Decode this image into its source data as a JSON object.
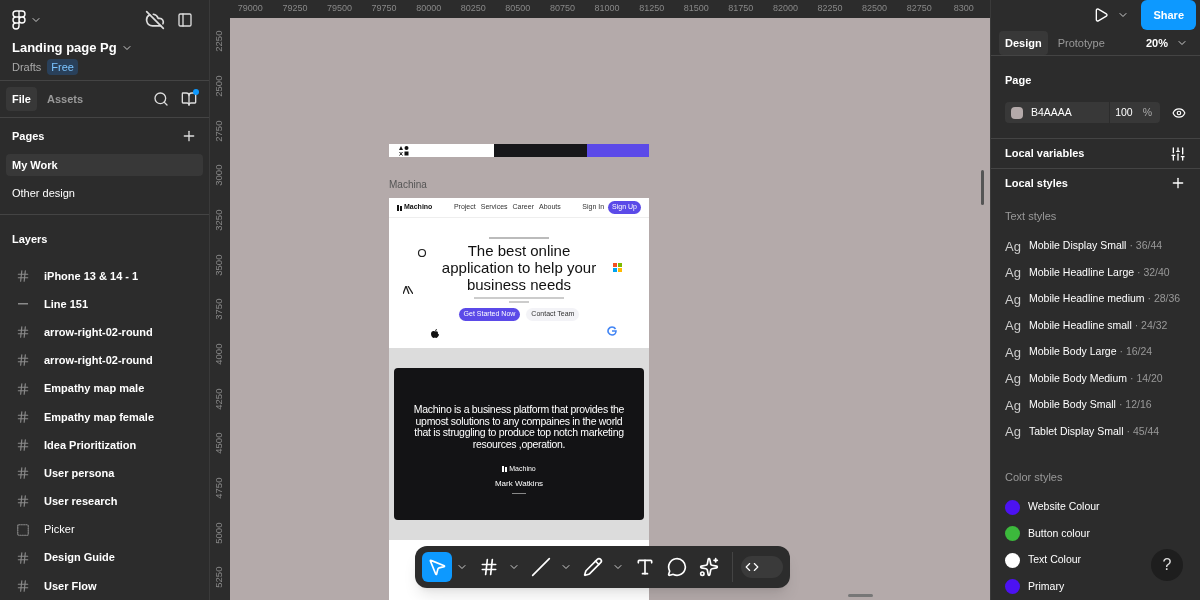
{
  "header": {
    "file_name": "Landing page Pg",
    "location": "Drafts",
    "plan_badge": "Free"
  },
  "left_tabs": [
    {
      "label": "File",
      "selected": true
    },
    {
      "label": "Assets",
      "selected": false
    }
  ],
  "pages": {
    "title": "Pages",
    "items": [
      {
        "label": "My Work",
        "selected": true
      },
      {
        "label": "Other design",
        "selected": false
      }
    ]
  },
  "layers": {
    "title": "Layers",
    "items": [
      {
        "label": "iPhone 13 & 14 - 1",
        "kind": "frame"
      },
      {
        "label": "Line 151",
        "kind": "line"
      },
      {
        "label": "arrow-right-02-round",
        "kind": "frame"
      },
      {
        "label": "arrow-right-02-round",
        "kind": "frame"
      },
      {
        "label": "Empathy map male",
        "kind": "frame"
      },
      {
        "label": "Empathy map female",
        "kind": "frame"
      },
      {
        "label": "Idea Prioritization",
        "kind": "frame"
      },
      {
        "label": "User persona",
        "kind": "frame"
      },
      {
        "label": "User research",
        "kind": "frame"
      },
      {
        "label": "Picker",
        "kind": "section"
      },
      {
        "label": "Design Guide",
        "kind": "frame"
      },
      {
        "label": "User Flow",
        "kind": "frame"
      }
    ]
  },
  "rulers": {
    "horizontal": [
      "79000",
      "79250",
      "79500",
      "79750",
      "80000",
      "80250",
      "80500",
      "80750",
      "81000",
      "81250",
      "81500",
      "81750",
      "82000",
      "82250",
      "82500",
      "82750",
      "8300"
    ],
    "vertical": [
      "2250",
      "2500",
      "2750",
      "3000",
      "3250",
      "3500",
      "3750",
      "4000",
      "4250",
      "4500",
      "4750",
      "5000",
      "5250"
    ]
  },
  "canvas": {
    "frame_label": "Machina",
    "design": {
      "logo": "Machino",
      "nav_links": [
        "Project",
        "Services",
        "Career",
        "Abouts"
      ],
      "sign_in": "Sign In",
      "sign_up": "Sign Up",
      "headline": "The  best online application to help your business needs",
      "primary_button": "Get Started Now",
      "secondary_button": "Contact Team",
      "quote": "Machino is a business platform that provides the upmost solutions to any compaines in the world that is struggling to produce top notch marketing resources ,operation.",
      "quote_logo": "Machino",
      "author": "Mark Watkins"
    }
  },
  "toolbar": {
    "tools": [
      {
        "kind": "move",
        "selected": true,
        "menu": true
      },
      {
        "kind": "frame",
        "selected": false,
        "menu": true
      },
      {
        "kind": "line",
        "selected": false,
        "menu": true
      },
      {
        "kind": "pencil",
        "selected": false,
        "menu": true
      },
      {
        "kind": "text",
        "selected": false,
        "menu": false
      },
      {
        "kind": "comment",
        "selected": false,
        "menu": false
      },
      {
        "kind": "ai",
        "selected": false,
        "menu": false
      }
    ],
    "dev_mode": {
      "on": false
    }
  },
  "right_panel": {
    "share_button": "Share",
    "tabs": [
      {
        "label": "Design",
        "selected": true
      },
      {
        "label": "Prototype",
        "selected": false
      }
    ],
    "zoom": "20%",
    "page": {
      "title": "Page",
      "color_hex": "B4AAAA",
      "opacity": "100",
      "unit": "%"
    },
    "local_variables": "Local variables",
    "local_styles": "Local styles",
    "text_styles": {
      "title": "Text styles",
      "items": [
        {
          "glyph": "Ag",
          "name": "Mobile Display Small",
          "spec": "· 36/44"
        },
        {
          "glyph": "Ag",
          "name": "Mobile Headline Large",
          "spec": "· 32/40"
        },
        {
          "glyph": "Ag",
          "name": "Mobile Headline medium",
          "spec": "· 28/36"
        },
        {
          "glyph": "Ag",
          "name": "Mobile Headline small",
          "spec": "· 24/32"
        },
        {
          "glyph": "Ag",
          "name": "Mobile Body Large",
          "spec": "· 16/24"
        },
        {
          "glyph": "Ag",
          "name": "Mobile Body Medium",
          "spec": "· 14/20"
        },
        {
          "glyph": "Ag",
          "name": "Mobile Body Small",
          "spec": "· 12/16"
        },
        {
          "glyph": "Ag",
          "name": "Tablet Display Small",
          "spec": "· 45/44"
        }
      ]
    },
    "color_styles": {
      "title": "Color styles",
      "items": [
        {
          "name": "Website Colour",
          "color": "#4c12f2"
        },
        {
          "name": "Button colour",
          "color": "#3cb93c"
        },
        {
          "name": "Text Colour",
          "color": "#ffffff"
        },
        {
          "name": "Primary",
          "color": "#4c12f2"
        }
      ]
    }
  },
  "help_button": "?"
}
